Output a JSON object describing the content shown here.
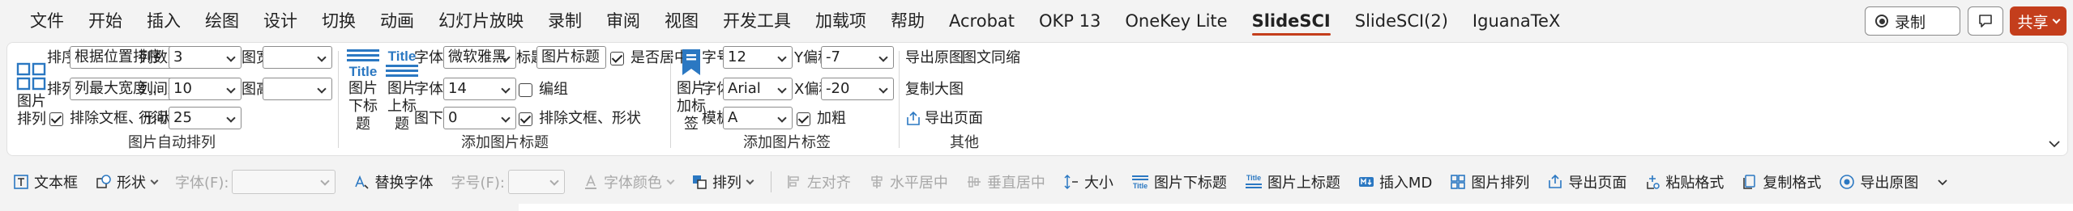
{
  "tabs": [
    {
      "label": "文件"
    },
    {
      "label": "开始"
    },
    {
      "label": "插入"
    },
    {
      "label": "绘图"
    },
    {
      "label": "设计"
    },
    {
      "label": "切换"
    },
    {
      "label": "动画"
    },
    {
      "label": "幻灯片放映"
    },
    {
      "label": "录制"
    },
    {
      "label": "审阅"
    },
    {
      "label": "视图"
    },
    {
      "label": "开发工具"
    },
    {
      "label": "加载项"
    },
    {
      "label": "帮助"
    },
    {
      "label": "Acrobat"
    },
    {
      "label": "OKP 13"
    },
    {
      "label": "OneKey Lite"
    },
    {
      "label": "SlideSCI"
    },
    {
      "label": "SlideSCI(2)"
    },
    {
      "label": "IguanaTeX"
    }
  ],
  "active_tab": "SlideSCI",
  "top_right": {
    "record_label": "录制",
    "share_label": "共享"
  },
  "colors": {
    "accent": "#c43e1c",
    "icon_blue": "#2b78c2"
  },
  "group_auto_arrange": {
    "label": "图片自动排列",
    "arrange_button": "图片\n排列",
    "sort_label": "排序",
    "sort_value": "根据位置排序",
    "layout_label": "排列",
    "layout_value": "列最大宽度...",
    "columns_label": "列数量",
    "columns_value": "3",
    "col_gap_label": "列间距",
    "col_gap_value": "10",
    "row_gap_label": "行间距",
    "row_gap_value": "25",
    "width_label": "图宽",
    "width_value": "",
    "height_label": "图高",
    "height_value": "",
    "exclude_label": "排除文框、形状",
    "exclude_checked": true
  },
  "group_add_title": {
    "label": "添加图片标题",
    "below_button": "图片\n下标题",
    "above_button": "图片\n上标题",
    "title_icon_text": "Title",
    "font_name_label": "字体名",
    "font_name_value": "微软雅黑",
    "font_size_label": "字体号",
    "font_size_value": "14",
    "below_gap_label": "图下距",
    "below_gap_value": "0",
    "title_label": "标题",
    "title_value": "图片标题",
    "center_label": "是否居中",
    "center_checked": true,
    "numbering_label": "编组",
    "numbering_checked": false,
    "exclude_label": "排除文框、形状",
    "exclude_checked": true
  },
  "group_add_label": {
    "label": "添加图片标签",
    "tag_button": "图片\n加标签",
    "size_label": "字号",
    "size_value": "12",
    "font_label": "字体",
    "font_value": "Arial",
    "template_label": "模板",
    "template_value": "A",
    "y_offset_label": "Y偏移",
    "y_offset_value": "-7",
    "x_offset_label": "X偏移",
    "x_offset_value": "-20",
    "bold_label": "加粗",
    "bold_checked": true
  },
  "group_other": {
    "label": "其他",
    "export_original": "导出原图",
    "copy_large": "复制大图",
    "export_page": "导出页面",
    "text_same_width": "图文同缩"
  },
  "quick_access": {
    "textbox": "文本框",
    "shape": "形状",
    "font_f": "字体(F):",
    "replace_font": "替换字体",
    "font_size_f": "字号(F):",
    "font_color": "字体颜色",
    "arrange": "排列",
    "align_left": "左对齐",
    "center_h": "水平居中",
    "center_v": "垂直居中",
    "size": "大小",
    "title_below": "图片下标题",
    "title_above": "图片上标题",
    "insert_md": "插入MD",
    "image_arrange": "图片排列",
    "export_page": "导出页面",
    "paste_format": "粘贴格式",
    "copy_format": "复制格式",
    "export_original": "导出原图"
  }
}
